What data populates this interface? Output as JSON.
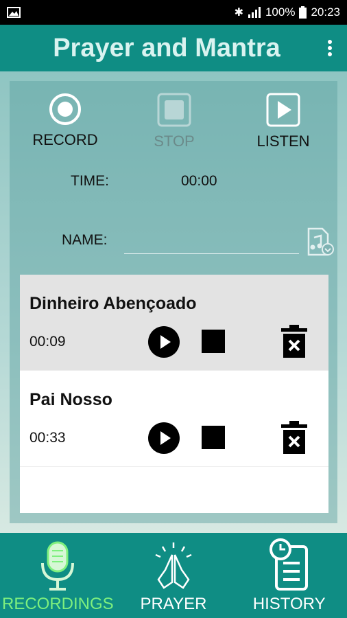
{
  "status_bar": {
    "battery": "100%",
    "time": "20:23"
  },
  "app_bar": {
    "title": "Prayer and Mantra"
  },
  "controls": {
    "record_label": "RECORD",
    "stop_label": "STOP",
    "listen_label": "LISTEN",
    "time_label": "TIME:",
    "time_value": "00:00",
    "name_label": "NAME:",
    "name_value": ""
  },
  "recordings": [
    {
      "name": "Dinheiro Abençoado",
      "duration": "00:09",
      "selected": true
    },
    {
      "name": "Pai Nosso",
      "duration": "00:33",
      "selected": false
    }
  ],
  "bottom_nav": {
    "tabs": [
      {
        "label": "RECORDINGS",
        "icon": "microphone-icon",
        "active": true
      },
      {
        "label": "PRAYER",
        "icon": "praying-hands-icon",
        "active": false
      },
      {
        "label": "HISTORY",
        "icon": "history-clipboard-icon",
        "active": false
      }
    ]
  },
  "colors": {
    "primary": "#0f8d84",
    "title": "#d9f3f0",
    "active_tab": "#7ef07e"
  }
}
